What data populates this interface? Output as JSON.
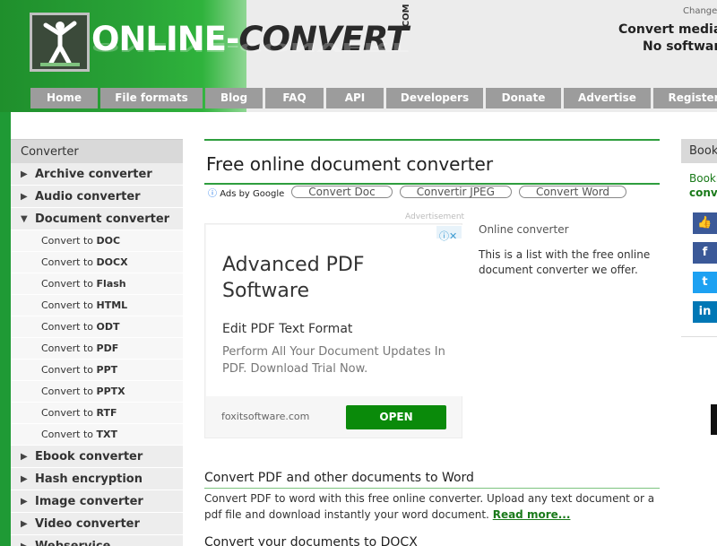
{
  "header": {
    "logo_part1": "ONLINE-",
    "logo_part2": "CONVERT",
    "logo_com": ".COM",
    "change_link": "Change",
    "tagline1": "Convert media",
    "tagline2": "No software"
  },
  "nav": [
    {
      "label": "Home",
      "width": 75
    },
    {
      "label": "File formats",
      "width": 114
    },
    {
      "label": "Blog",
      "width": 64
    },
    {
      "label": "FAQ",
      "width": 65
    },
    {
      "label": "API",
      "width": 64
    },
    {
      "label": "Developers",
      "width": 108
    },
    {
      "label": "Donate",
      "width": 84
    },
    {
      "label": "Advertise",
      "width": 97
    },
    {
      "label": "Register",
      "width": 90
    }
  ],
  "sidebar": {
    "heading": "Converter",
    "items": [
      {
        "type": "cat",
        "label": "Archive converter",
        "arrow": "▶"
      },
      {
        "type": "cat",
        "label": "Audio converter",
        "arrow": "▶"
      },
      {
        "type": "cat",
        "label": "Document converter",
        "arrow": "▼"
      },
      {
        "type": "sub",
        "prefix": "Convert to ",
        "format": "DOC"
      },
      {
        "type": "sub",
        "prefix": "Convert to ",
        "format": "DOCX"
      },
      {
        "type": "sub",
        "prefix": "Convert to ",
        "format": "Flash"
      },
      {
        "type": "sub",
        "prefix": "Convert to ",
        "format": "HTML"
      },
      {
        "type": "sub",
        "prefix": "Convert to ",
        "format": "ODT"
      },
      {
        "type": "sub",
        "prefix": "Convert to ",
        "format": "PDF"
      },
      {
        "type": "sub",
        "prefix": "Convert to ",
        "format": "PPT"
      },
      {
        "type": "sub",
        "prefix": "Convert to ",
        "format": "PPTX"
      },
      {
        "type": "sub",
        "prefix": "Convert to ",
        "format": "RTF"
      },
      {
        "type": "sub",
        "prefix": "Convert to ",
        "format": "TXT"
      },
      {
        "type": "cat",
        "label": "Ebook converter",
        "arrow": "▶"
      },
      {
        "type": "cat",
        "label": "Hash encryption",
        "arrow": "▶"
      },
      {
        "type": "cat",
        "label": "Image converter",
        "arrow": "▶"
      },
      {
        "type": "cat",
        "label": "Video converter",
        "arrow": "▶"
      },
      {
        "type": "cat",
        "label": "Webservice",
        "arrow": "▶"
      }
    ]
  },
  "main": {
    "title": "Free online document converter",
    "ads_by_google": "Ads by Google",
    "ad_links": [
      "Convert Doc",
      "Convertir JPEG",
      "Convert Word"
    ],
    "advertisement_label": "Advertisement",
    "ad": {
      "title": "Advanced PDF Software",
      "subtitle": "Edit PDF Text Format",
      "body": "Perform All Your Document Updates In PDF. Download Trial Now.",
      "domain": "foxitsoftware.com",
      "cta": "OPEN"
    },
    "online_converter_label": "Online converter",
    "online_converter_text": "This is a list with the free online document converter we offer.",
    "sections": [
      {
        "title": "Convert PDF and other documents to Word",
        "text": "Convert PDF to word with this free online converter. Upload any text document or a pdf file and download instantly your word document.",
        "link": "Read more..."
      },
      {
        "title": "Convert your documents to DOCX",
        "text": "",
        "link": ""
      }
    ]
  },
  "right": {
    "heading": "Bookmark",
    "bookmark_line1": "Bookmark",
    "bookmark_line2": "convert",
    "social": [
      {
        "name": "like",
        "color": "#3b5998",
        "glyph": "👍"
      },
      {
        "name": "facebook",
        "color": "#3b5998",
        "glyph": "f"
      },
      {
        "name": "twitter",
        "color": "#1da1f2",
        "glyph": "t"
      },
      {
        "name": "linkedin",
        "color": "#0077b5",
        "glyph": "in"
      }
    ]
  }
}
